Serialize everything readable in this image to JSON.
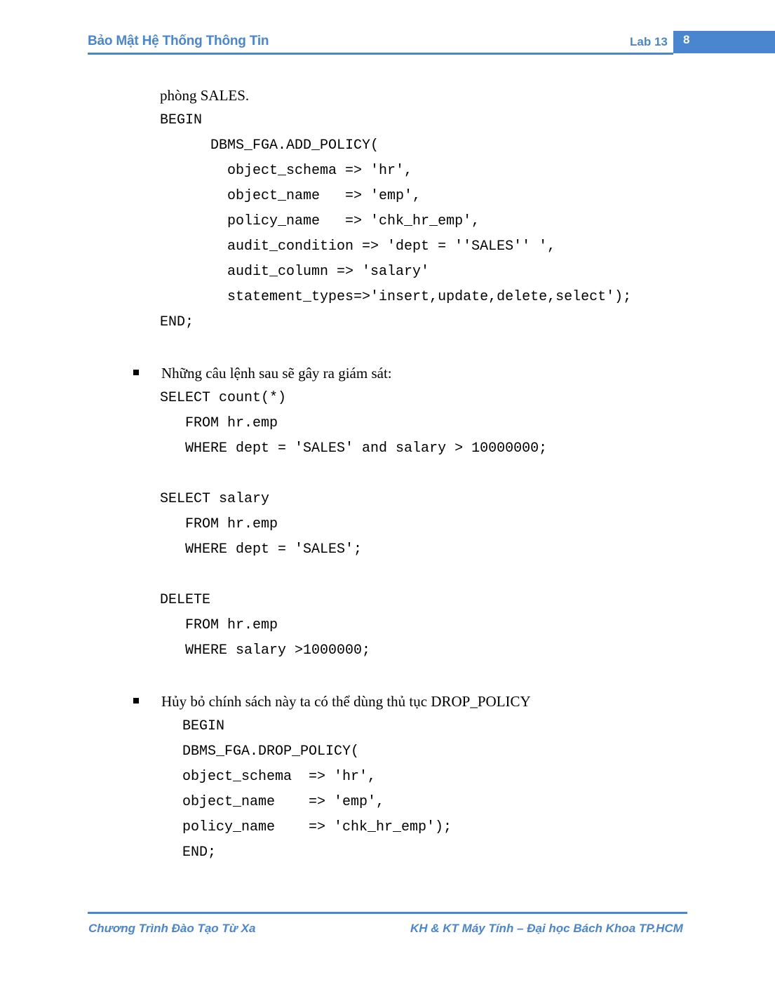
{
  "header": {
    "title": "Bảo Mật Hệ Thống Thông Tin",
    "lab_label": "Lab 13",
    "page_number": "8",
    "accent_color": "#4a86d0"
  },
  "body": {
    "intro_line": "phòng SALES.",
    "add_policy_code": [
      "BEGIN",
      "      DBMS_FGA.ADD_POLICY(",
      "        object_schema => 'hr',",
      "        object_name   => 'emp',",
      "        policy_name   => 'chk_hr_emp',",
      "        audit_condition => 'dept = ''SALES'' ',",
      "        audit_column => 'salary'",
      "        statement_types=>'insert,update,delete,select');",
      "END;"
    ],
    "bullet1": {
      "marker": "square-bullet",
      "text": "Những câu lệnh sau sẽ gây ra giám sát:",
      "code_groups": [
        [
          "SELECT count(*)",
          "   FROM hr.emp",
          "   WHERE dept = 'SALES' and salary > 10000000;"
        ],
        [
          "SELECT salary",
          "   FROM hr.emp",
          "   WHERE dept = 'SALES';"
        ],
        [
          "DELETE",
          "   FROM hr.emp",
          "   WHERE salary >1000000;"
        ]
      ]
    },
    "bullet2": {
      "marker": "square-bullet",
      "text": "Hủy bỏ chính sách này ta có thể dùng thủ tục DROP_POLICY",
      "code": [
        "BEGIN",
        "DBMS_FGA.DROP_POLICY(",
        "object_schema  => 'hr',",
        "object_name    => 'emp',",
        "policy_name    => 'chk_hr_emp');",
        "END;"
      ]
    }
  },
  "footer": {
    "left": "Chương Trình Đào Tạo Từ Xa",
    "right": "KH & KT Máy Tính – Đại học Bách Khoa TP.HCM"
  }
}
